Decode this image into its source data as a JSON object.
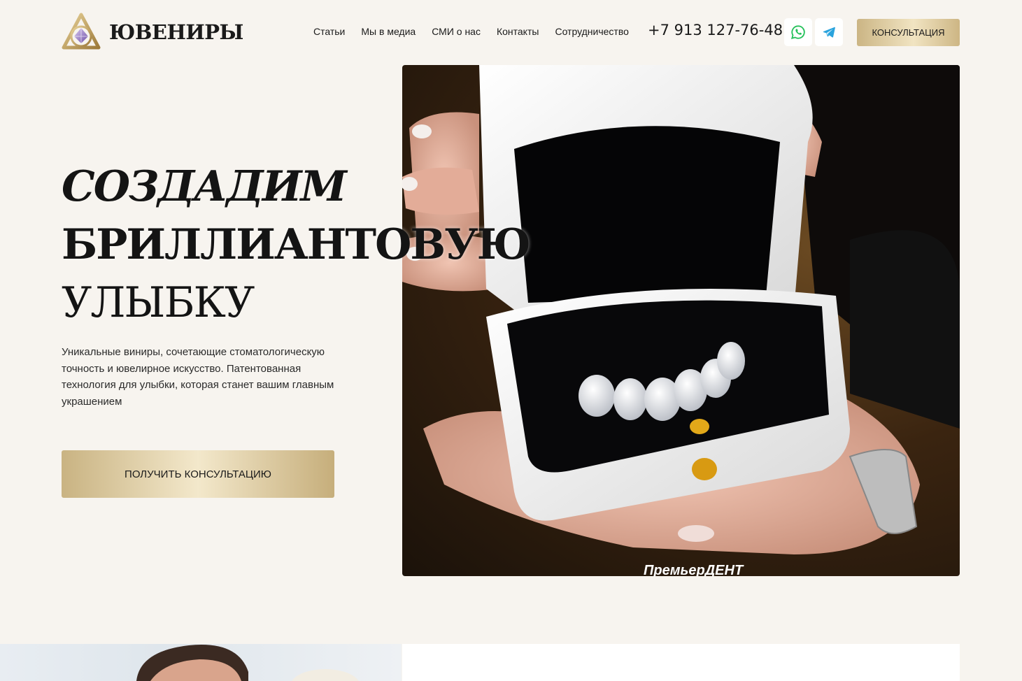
{
  "brand": {
    "name": "ЮВЕНИРЫ",
    "logo_icon": "triangle-diamond-logo",
    "accent_gold": "#c9b382"
  },
  "nav": {
    "items": [
      {
        "label": "Статьи"
      },
      {
        "label": "Мы в медиа"
      },
      {
        "label": "СМИ о нас"
      },
      {
        "label": "Контакты"
      },
      {
        "label": "Сотрудничество"
      }
    ]
  },
  "contacts": {
    "phone": "+7 913 127-76-48",
    "whatsapp_icon": "whatsapp-icon",
    "telegram_icon": "telegram-icon"
  },
  "header": {
    "consult_label": "КОНСУЛЬТАЦИЯ"
  },
  "hero": {
    "title_line1": "СОЗДАДИМ",
    "title_line2": "БРИЛЛИАНТОВУЮ",
    "title_line3": "УЛЫБКУ",
    "lead": "Уникальные виниры, сочетающие стоматологическую точность и ювелирное искусство. Патентованная технология для улыбки, которая станет вашим главным украшением",
    "cta_label": "ПОЛУЧИТЬ КОНСУЛЬТАЦИЮ",
    "photo_watermark": "ПремьерДЕНТ"
  }
}
